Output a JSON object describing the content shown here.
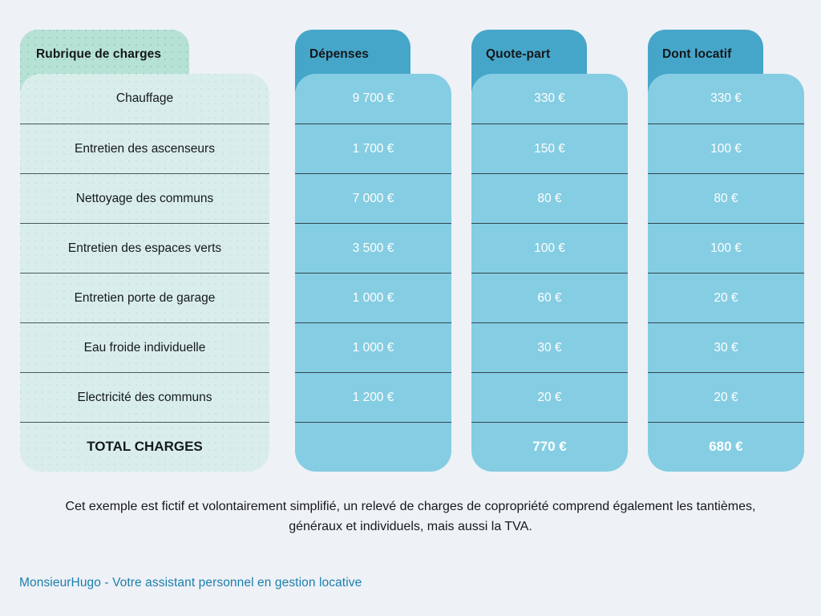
{
  "background_color": "#eef1f6",
  "theme": {
    "green_header": "#b6e2d6",
    "green_body": "#d9eeeb",
    "blue_header": "#46a6c9",
    "blue_body": "#85cde2",
    "brand_color": "#1a7fae"
  },
  "columns": [
    {
      "key": "rubrique",
      "header": "Rubrique de charges",
      "theme": "green",
      "cells": [
        "Chauffage",
        "Entretien des ascenseurs",
        "Nettoyage des communs",
        "Entretien des espaces verts",
        "Entretien porte de garage",
        "Eau froide individuelle",
        "Electricité des communs"
      ],
      "total": "TOTAL CHARGES"
    },
    {
      "key": "depenses",
      "header": "Dépenses",
      "theme": "blue",
      "cells": [
        "9 700 €",
        "1 700 €",
        "7 000 €",
        "3 500 €",
        "1 000 €",
        "1 000 €",
        "1 200 €"
      ],
      "total": ""
    },
    {
      "key": "quote-part",
      "header": "Quote-part",
      "theme": "blue",
      "cells": [
        "330 €",
        "150 €",
        "80 €",
        "100 €",
        "60 €",
        "30 €",
        "20 €"
      ],
      "total": "770 €"
    },
    {
      "key": "dont-locatif",
      "header": "Dont locatif",
      "theme": "blue",
      "cells": [
        "330 €",
        "100 €",
        "80 €",
        "100 €",
        "20 €",
        "30 €",
        "20 €"
      ],
      "total": "680 €"
    }
  ],
  "footnote": "Cet exemple est fictif et volontairement simplifié, un relevé de charges de copropriété comprend également les tantièmes, généraux et individuels, mais aussi la TVA.",
  "brand": "MonsieurHugo - Votre assistant personnel en gestion locative"
}
